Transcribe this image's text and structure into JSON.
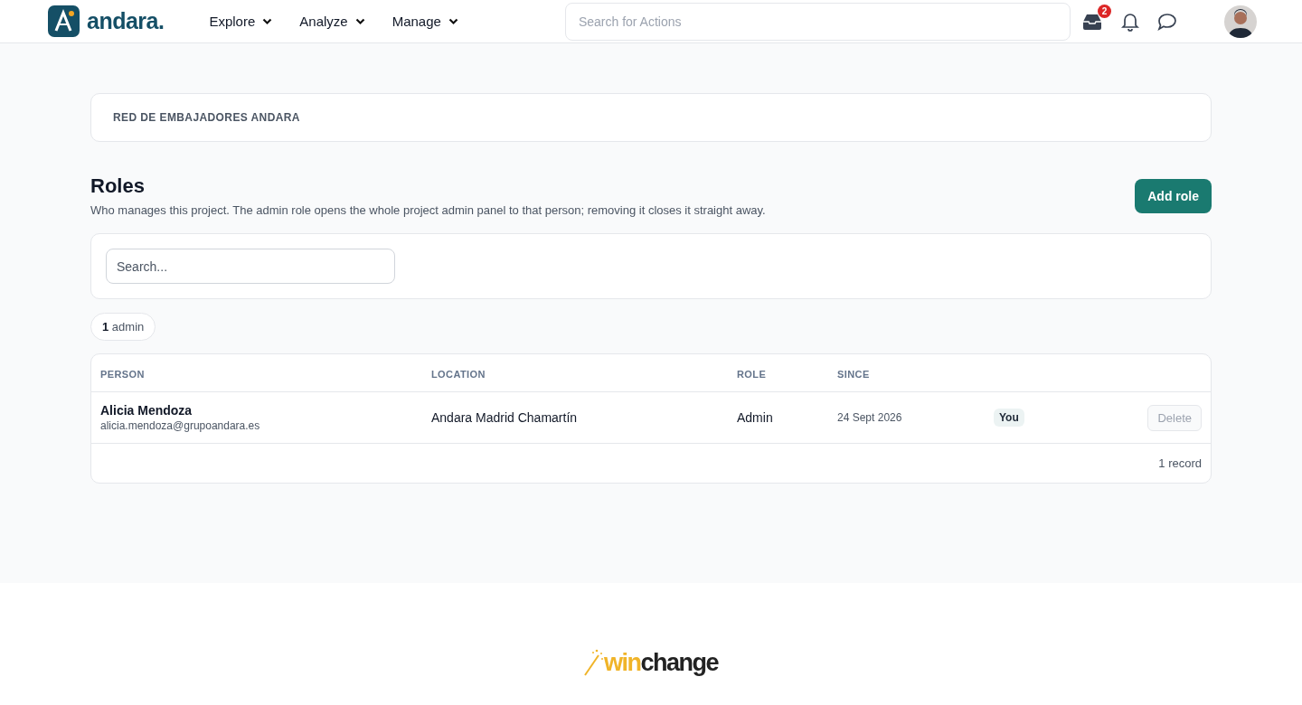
{
  "header": {
    "brand": "andara.",
    "nav": [
      {
        "label": "Explore"
      },
      {
        "label": "Analyze"
      },
      {
        "label": "Manage"
      }
    ],
    "search": {
      "placeholder": "Search for Actions"
    },
    "inbox_badge": "2"
  },
  "breadcrumb": "RED DE EMBAJADORES ANDARA",
  "page": {
    "title": "Roles",
    "description": "Who manages this project. The admin role opens the whole project admin panel to that person; removing it closes it straight away.",
    "add_button": "Add role"
  },
  "filter": {
    "placeholder": "Search..."
  },
  "summary_chip": "**1** admin",
  "table": {
    "columns": [
      "PERSON",
      "LOCATION",
      "ROLE",
      "SINCE"
    ],
    "rows": [
      {
        "name": "Alicia Mendoza",
        "email": "alicia.mendoza@grupoandara.es",
        "location": "Andara Madrid Chamartín",
        "role": "Admin",
        "since": "24 Sept 2026",
        "tag": "You",
        "action": {
          "label": "Delete",
          "disabled": true
        }
      }
    ],
    "footer": "1 record"
  },
  "footer": {
    "logo_part_1": "win",
    "logo_part_2": "change"
  }
}
